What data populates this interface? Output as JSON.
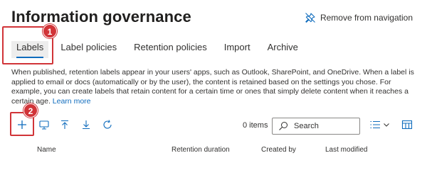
{
  "page": {
    "title": "Information governance",
    "remove_nav_label": "Remove from navigation"
  },
  "tabs": [
    {
      "label": "Labels",
      "active": true
    },
    {
      "label": "Label policies"
    },
    {
      "label": "Retention policies"
    },
    {
      "label": "Import"
    },
    {
      "label": "Archive"
    }
  ],
  "description": {
    "text": "When published, retention labels appear in your users' apps, such as Outlook, SharePoint, and OneDrive. When a label is applied to email or docs (automatically or by the user), the content is retained based on the settings you chose. For example, you can create labels that retain content for a certain time or ones that simply delete content when it reaches a certain age.",
    "learn_more": "Learn more"
  },
  "callouts": [
    "1",
    "2"
  ],
  "toolbar": {
    "icons": [
      "add-icon",
      "publish-icon",
      "import-icon",
      "export-icon",
      "refresh-icon",
      "list-view-icon",
      "chevron-down-icon",
      "columns-icon"
    ],
    "items_count": "0 items",
    "search_placeholder": "Search"
  },
  "table": {
    "columns": [
      "Name",
      "Retention duration",
      "Created by",
      "Last modified"
    ]
  },
  "colors": {
    "accent": "#0f6cbd",
    "callout": "#d13438"
  }
}
